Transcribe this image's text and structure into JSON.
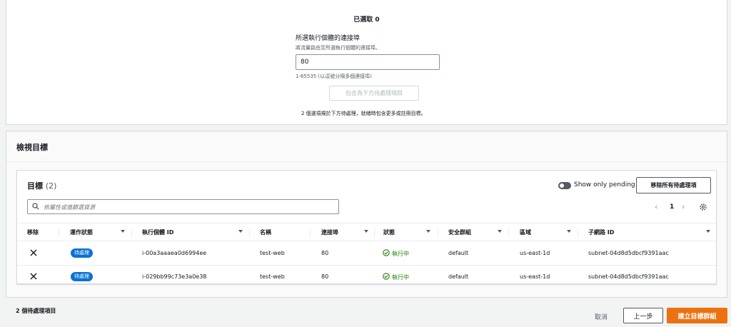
{
  "selection": {
    "count_label": "已選取 0"
  },
  "port_form": {
    "label": "所選執行個體的連接埠",
    "description": "將流量路由至所選執行個體的連接埠。",
    "value": "80",
    "hint": "1-65535 (以逗號分隔多個連接埠)",
    "include_button": "包含為下方待處理項目",
    "pending_note": "2 個選項規於下方待處理，就緒時包含更多或註冊目標。"
  },
  "review": {
    "title": "檢視目標"
  },
  "targets": {
    "title": "目標",
    "count": "(2)",
    "toggle_label": "Show only pending",
    "remove_all_button": "移除所有待處理項",
    "search_placeholder": "依屬性或值篩選資源",
    "page": "1",
    "columns": [
      "移除",
      "運作狀態",
      "執行個體 ID",
      "名稱",
      "連接埠",
      "狀態",
      "安全群組",
      "區域",
      "子網路 ID"
    ],
    "rows": [
      {
        "health": "待處理",
        "instance_id": "i-00a3aaaea0d6994ee",
        "name": "test-web",
        "port": "80",
        "state": "執行中",
        "security_group": "default",
        "zone": "us-east-1d",
        "subnet_id": "subnet-04d8d5dbcf9391aac"
      },
      {
        "health": "待處理",
        "instance_id": "i-029bb99c73e3a0e38",
        "name": "test-web",
        "port": "80",
        "state": "執行中",
        "security_group": "default",
        "zone": "us-east-1d",
        "subnet_id": "subnet-04d8d5dbcf9391aac"
      }
    ]
  },
  "footer": {
    "pending_count": "2 個待處理項目",
    "cancel": "取消",
    "previous": "上一步",
    "create": "建立目標群組"
  },
  "colors": {
    "primary": "#ec7211",
    "badge": "#0972d3",
    "success": "#1d8102"
  },
  "icons": [
    "search-icon",
    "settings-gear-icon",
    "chevron-left-icon",
    "chevron-right-icon",
    "close-x-icon",
    "check-circle-icon",
    "sort-caret-icon",
    "toggle-switch"
  ]
}
